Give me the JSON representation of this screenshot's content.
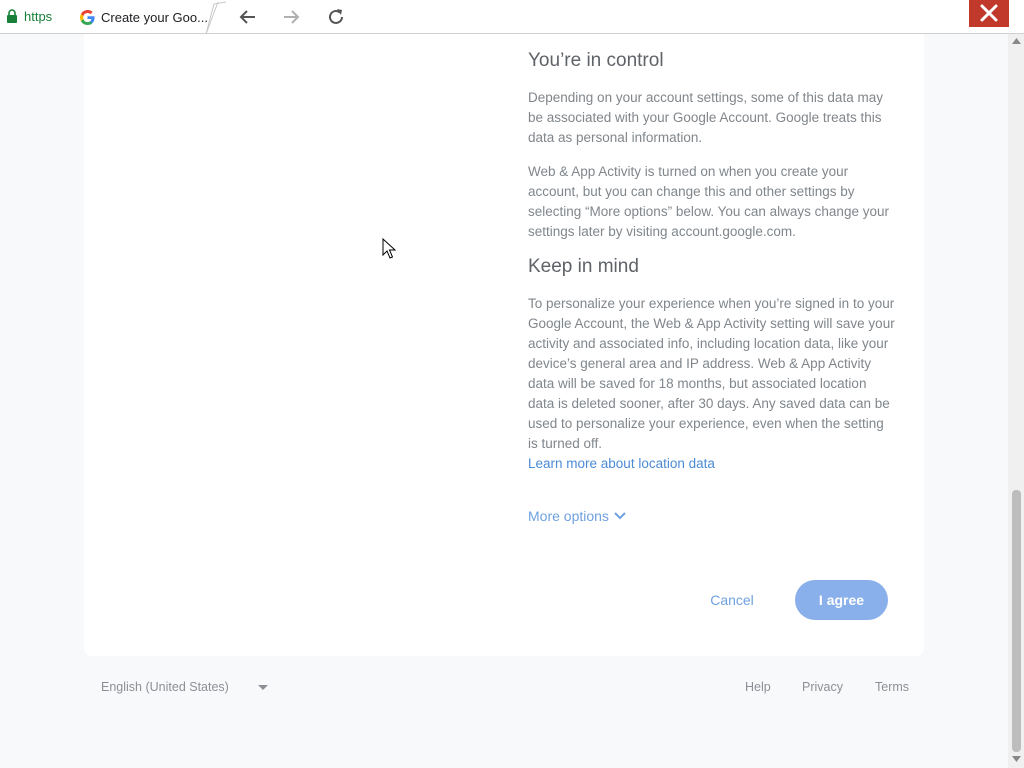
{
  "browser": {
    "protocol_label": "https",
    "tab_title": "Create your Goo...",
    "colors": {
      "secure": "#188038",
      "close": "#c0392b"
    }
  },
  "content": {
    "section1": {
      "heading": "You’re in control",
      "para1": "Depending on your account settings, some of this data may be associated with your Google Account. Google treats this data as personal information.",
      "para2": "Web & App Activity is turned on when you create your account, but you can change this and other settings by selecting “More options” below. You can always change your settings later by visiting account.google.com."
    },
    "section2": {
      "heading": "Keep in mind",
      "para1": "To personalize your experience when you’re signed in to your Google Account, the Web & App Activity setting will save your activity and associated info, including location data, like your device’s general area and IP address. Web & App Activity data will be saved for 18 months, but associated location data is deleted sooner, after 30 days. Any saved data can be used to personalize your experience, even when the setting is turned off.",
      "learn_more_link": "Learn more about location data"
    },
    "more_options": "More options",
    "buttons": {
      "cancel": "Cancel",
      "agree": "I agree"
    }
  },
  "footer": {
    "language": "English (United States)",
    "help": "Help",
    "privacy": "Privacy",
    "terms": "Terms"
  }
}
